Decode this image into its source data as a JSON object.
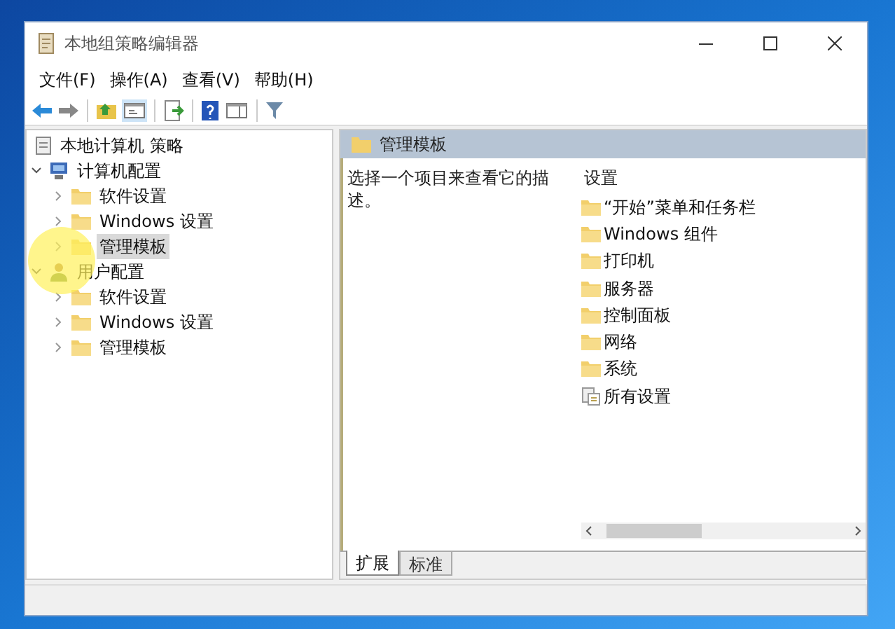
{
  "window": {
    "title": "本地组策略编辑器"
  },
  "menu": [
    "文件(F)",
    "操作(A)",
    "查看(V)",
    "帮助(H)"
  ],
  "tree": {
    "label": "本地计算机 策略",
    "children": [
      {
        "label": "计算机配置",
        "kind": "computer",
        "expanded": true,
        "selected": false,
        "children": [
          {
            "label": "软件设置",
            "kind": "folder",
            "expanded": false,
            "selected": false
          },
          {
            "label": "Windows 设置",
            "kind": "folder",
            "expanded": false,
            "selected": false
          },
          {
            "label": "管理模板",
            "kind": "folder",
            "expanded": false,
            "selected": true
          }
        ]
      },
      {
        "label": "用户配置",
        "kind": "user",
        "expanded": true,
        "selected": false,
        "children": [
          {
            "label": "软件设置",
            "kind": "folder",
            "expanded": false,
            "selected": false
          },
          {
            "label": "Windows 设置",
            "kind": "folder",
            "expanded": false,
            "selected": false
          },
          {
            "label": "管理模板",
            "kind": "folder",
            "expanded": false,
            "selected": false
          }
        ]
      }
    ]
  },
  "details": {
    "header": "管理模板",
    "description": "选择一个项目来查看它的描述。",
    "column_heading": "设置",
    "items": [
      {
        "label": "“开始”菜单和任务栏",
        "kind": "folder"
      },
      {
        "label": "Windows 组件",
        "kind": "folder"
      },
      {
        "label": "打印机",
        "kind": "folder"
      },
      {
        "label": "服务器",
        "kind": "folder"
      },
      {
        "label": "控制面板",
        "kind": "folder"
      },
      {
        "label": "网络",
        "kind": "folder"
      },
      {
        "label": "系统",
        "kind": "folder"
      },
      {
        "label": "所有设置",
        "kind": "settings"
      }
    ]
  },
  "tabs": [
    {
      "label": "扩展",
      "selected": true
    },
    {
      "label": "标准",
      "selected": false
    }
  ]
}
